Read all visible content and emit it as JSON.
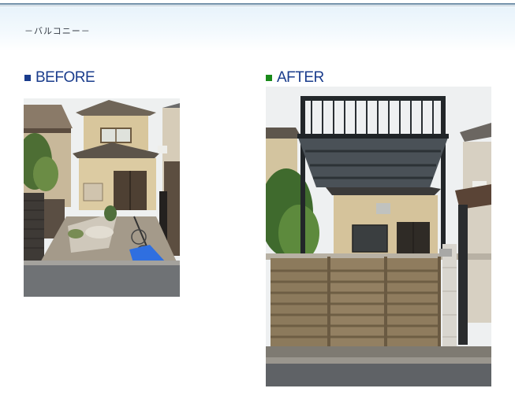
{
  "page": {
    "title": "－バルコニー－"
  },
  "before": {
    "label": "BEFORE",
    "marker_color": "#1a3c8c",
    "photo_alt": "二階建て住宅の改装前の写真（門扉・バルコニーなし）"
  },
  "after": {
    "label": "AFTER",
    "marker_color": "#1a8a1a",
    "photo_alt": "バルコニー屋根とアルミ門扉を設置した改装後の写真"
  },
  "colors": {
    "header_bg": "#e8f3fb",
    "label_text": "#1a3c8c"
  }
}
